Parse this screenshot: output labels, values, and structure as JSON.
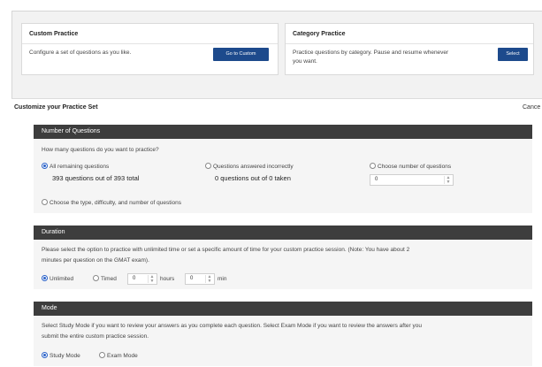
{
  "custom_card": {
    "title": "Custom Practice",
    "description": "Configure a set of questions as you like.",
    "button": "Go to Custom"
  },
  "category_card": {
    "title": "Category Practice",
    "description_line1": "Practice questions by category. Pause and resume whenever",
    "description_line2": "you want.",
    "button": "Select"
  },
  "panel": {
    "title": "Customize your Practice Set",
    "cancel": "Cance"
  },
  "number_section": {
    "header": "Number of Questions",
    "prompt": "How many questions do you want to practice?",
    "options": [
      {
        "label": "All remaining questions",
        "detail": "393 questions out of 393 total",
        "selected": true
      },
      {
        "label": "Questions answered incorrectly",
        "detail": "0 questions out of 0 taken",
        "selected": false
      },
      {
        "label": "Choose number of questions",
        "input_value": "0",
        "selected": false
      }
    ],
    "type_option": "Choose the type, difficulty, and number of questions"
  },
  "duration_section": {
    "header": "Duration",
    "desc_line1": "Please select the option to practice with unlimited time or set a specific amount of time for your custom practice session. (Note: You have about 2",
    "desc_line2": "minutes per question on the GMAT exam).",
    "unlimited": "Unlimited",
    "timed": "Timed",
    "hours_value": "0",
    "hours_label": "hours",
    "min_value": "0",
    "min_label": "min",
    "selected": "Unlimited"
  },
  "mode_section": {
    "header": "Mode",
    "desc_line1": "Select Study Mode if you want to review your answers as you complete each question. Select Exam Mode if you want to review the answers after you",
    "desc_line2": "submit the entire custom practice session.",
    "study": "Study Mode",
    "exam": "Exam Mode",
    "selected": "Study Mode"
  },
  "colors": {
    "button": "#1d4a8c",
    "section_header": "#3d3d3d",
    "radio_selected": "#2a62c9"
  },
  "icons": {
    "radio": "radio-icon",
    "spinner": "spinner-arrows-icon"
  }
}
